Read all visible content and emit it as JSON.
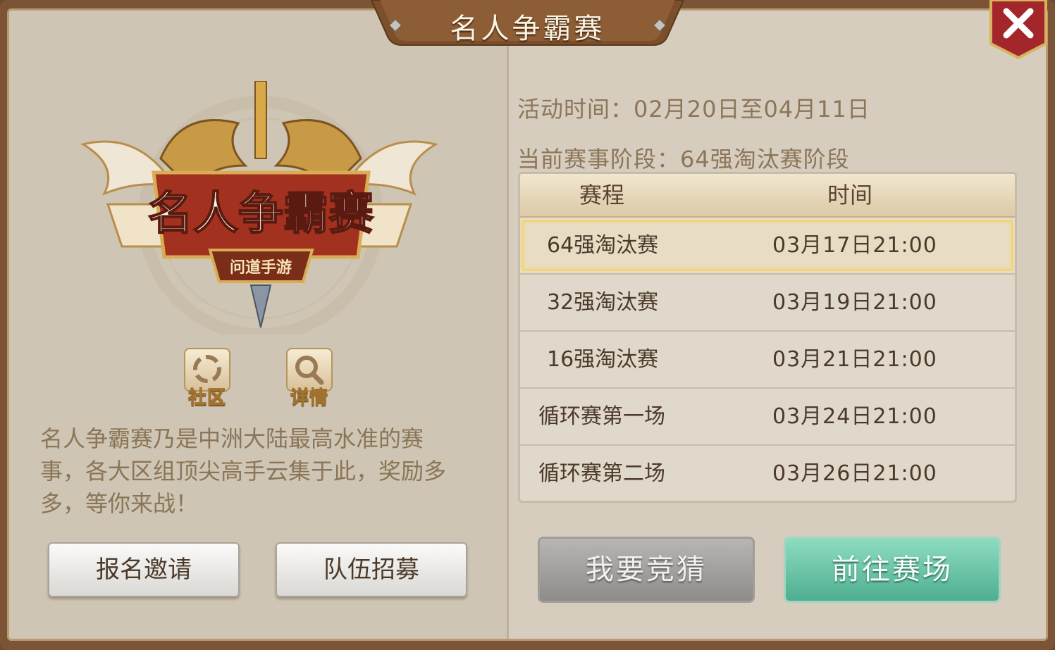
{
  "window": {
    "title": "名人争霸赛"
  },
  "logo": {
    "main_text": "名人争霸赛",
    "sub_text": "问道手游"
  },
  "icons": [
    {
      "name": "community",
      "label": "社区"
    },
    {
      "name": "details",
      "label": "详情"
    }
  ],
  "description": "名人争霸赛乃是中洲大陆最高水准的赛事，各大区组顶尖高手云集于此，奖励多多，等你来战！",
  "left_buttons": {
    "signup": "报名邀请",
    "recruit": "队伍招募"
  },
  "info": {
    "activity_time": "活动时间：02月20日至04月11日",
    "current_stage": "当前赛事阶段：64强淘汰赛阶段"
  },
  "schedule": {
    "headers": [
      "赛程",
      "时间"
    ],
    "rows": [
      {
        "stage": "64强淘汰赛",
        "time": "03月17日21:00"
      },
      {
        "stage": "32强淘汰赛",
        "time": "03月19日21:00"
      },
      {
        "stage": "16强淘汰赛",
        "time": "03月21日21:00"
      },
      {
        "stage": "循环赛第一场",
        "time": "03月24日21:00"
      },
      {
        "stage": "循环赛第二场",
        "time": "03月26日21:00"
      }
    ]
  },
  "right_buttons": {
    "guess": "我要竞猜",
    "arena": "前往赛场"
  },
  "colors": {
    "frame": "#7a5434",
    "panel": "#d9d1c3",
    "accent_gold": "#f2d57a",
    "arena_green": "#4fae91",
    "close_red": "#a3262a"
  }
}
